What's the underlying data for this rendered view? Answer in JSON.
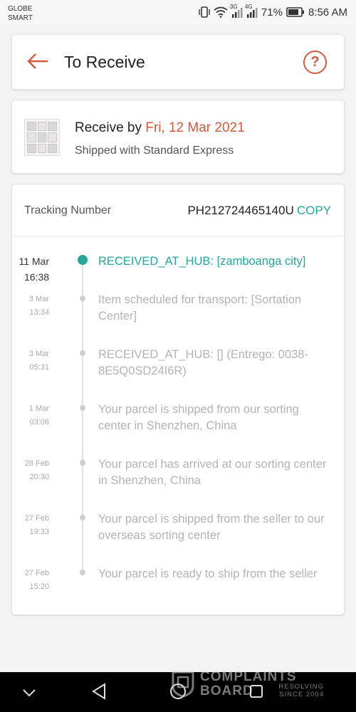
{
  "status_bar": {
    "carrier_line1": "GLOBE",
    "carrier_line2": "SMART",
    "network1": "3G",
    "network2": "4G",
    "battery": "71%",
    "time": "8:56 AM",
    "icons": [
      "vibrate-icon",
      "wifi-icon",
      "signal-icon",
      "battery-icon"
    ]
  },
  "header": {
    "title": "To Receive",
    "back_icon": "arrow-left-icon",
    "help_label": "?",
    "accent_color": "#d35a3a"
  },
  "delivery": {
    "receive_prefix": "Receive by ",
    "receive_date": "Fri, 12 Mar 2021",
    "shipped_text": "Shipped with Standard Express"
  },
  "tracking": {
    "label": "Tracking Number",
    "number": "PH212724465140U",
    "copy_label": "COPY",
    "copy_color": "#26a69a",
    "events": [
      {
        "date": "11 Mar",
        "time": "16:38",
        "text": "RECEIVED_AT_HUB: [zamboanga city]",
        "current": true
      },
      {
        "date": "3 Mar",
        "time": "13:34",
        "text": "Item scheduled for transport: [Sortation Center]"
      },
      {
        "date": "3 Mar",
        "time": "05:31",
        "text": "RECEIVED_AT_HUB: [] (Entrego: 0038-8E5Q0SD24I6R)"
      },
      {
        "date": "1 Mar",
        "time": "03:06",
        "text": "Your parcel is shipped from our sorting center in Shenzhen, China"
      },
      {
        "date": "28 Feb",
        "time": "20:30",
        "text": "Your parcel has arrived at our sorting center in Shenzhen, China"
      },
      {
        "date": "27 Feb",
        "time": "19:33",
        "text": "Your parcel is shipped from the seller to our overseas sorting center"
      },
      {
        "date": "27 Feb",
        "time": "15:20",
        "text": "Your parcel is ready to ship from the seller"
      }
    ]
  },
  "watermark": {
    "line1": "COMPLAINTS",
    "line2": "BOARD",
    "sub1": "RESOLVING",
    "sub2": "SINCE 2004"
  },
  "nav": {
    "icons": [
      "chevron-down-icon",
      "back-triangle-icon",
      "home-circle-icon",
      "recents-square-icon"
    ]
  }
}
